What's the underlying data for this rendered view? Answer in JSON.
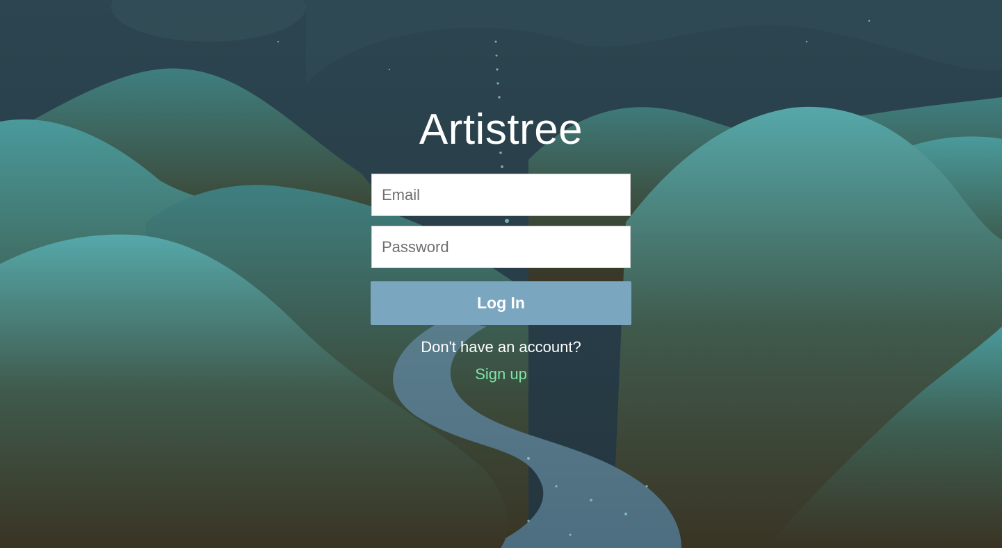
{
  "app": {
    "title": "Artistree"
  },
  "login_form": {
    "email_placeholder": "Email",
    "password_placeholder": "Password",
    "submit_label": "Log In"
  },
  "signup": {
    "prompt": "Don't have an account?",
    "link_label": "Sign up"
  },
  "colors": {
    "button": "#7aa6bf",
    "link": "#7ee6a9",
    "text": "#ffffff"
  }
}
